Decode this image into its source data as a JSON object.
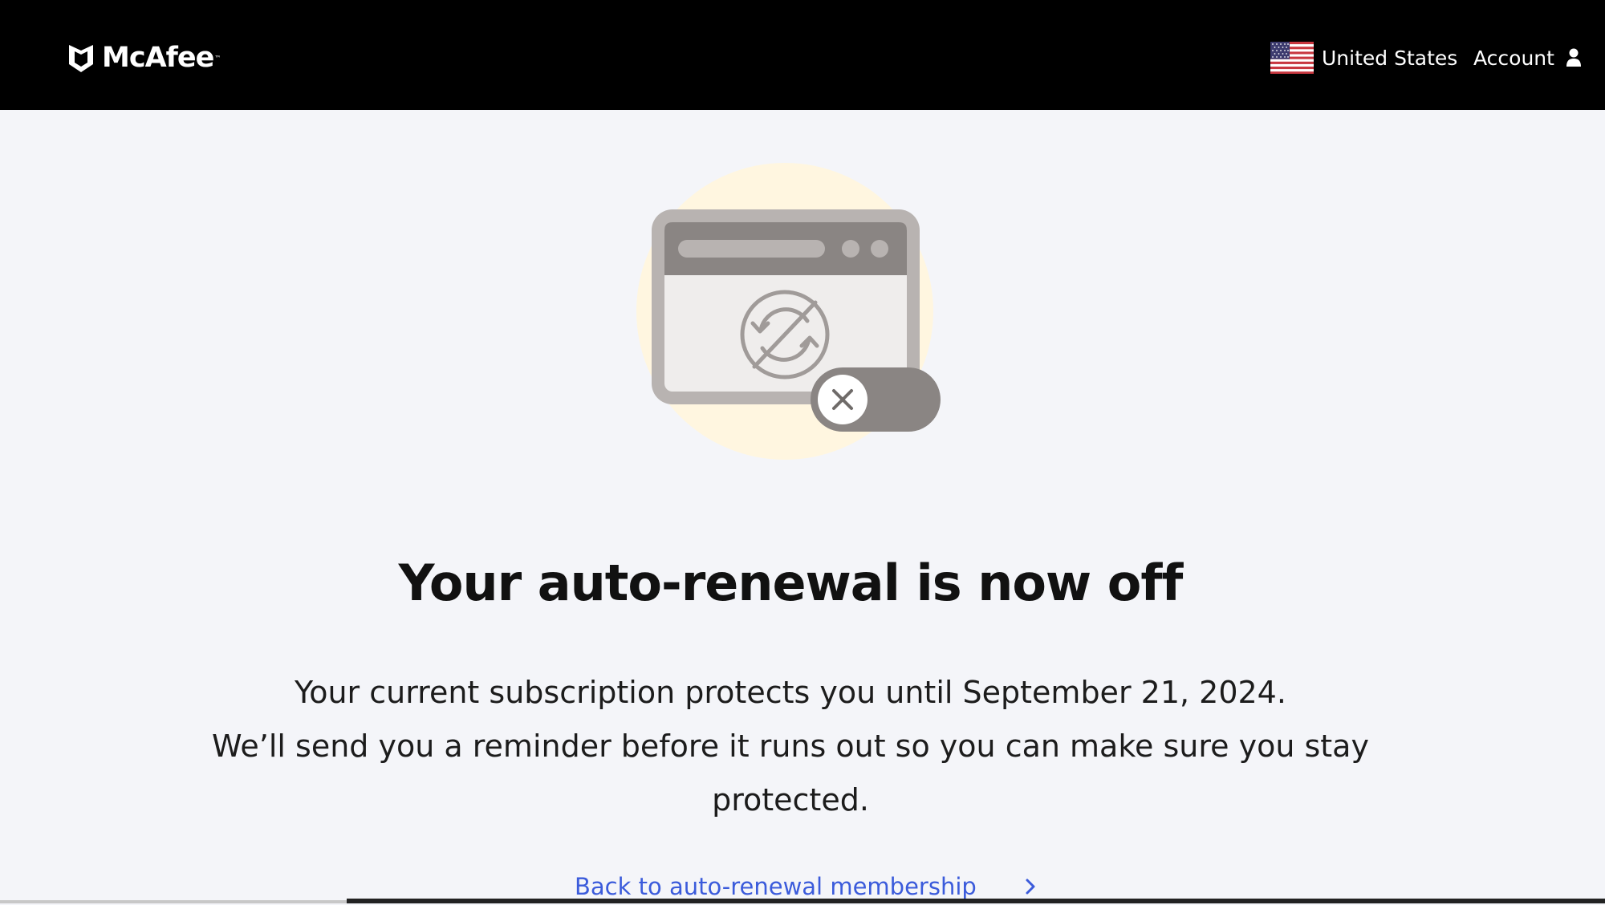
{
  "header": {
    "brand_name": "McAfee",
    "brand_trademark": "™",
    "country_label": "United States",
    "account_label": "Account"
  },
  "icons": {
    "logo": "mcafee-shield-icon",
    "flag": "us-flag-icon",
    "account": "user-icon",
    "hero": "auto-renewal-off-illustration",
    "chevron": "chevron-right-icon"
  },
  "main": {
    "headline": "Your auto-renewal is now off",
    "body_line_1": "Your current subscription protects you until September 21, 2024.",
    "body_line_2": "We’ll send you a reminder before it runs out so you can make sure you stay protected.",
    "back_link_label": "Back to auto-renewal membership"
  },
  "colors": {
    "header_bg": "#000000",
    "page_bg": "#f4f5f9",
    "link": "#3b5bdb",
    "hero_glow": "#fff6e0",
    "hero_gray": "#8a8583"
  }
}
